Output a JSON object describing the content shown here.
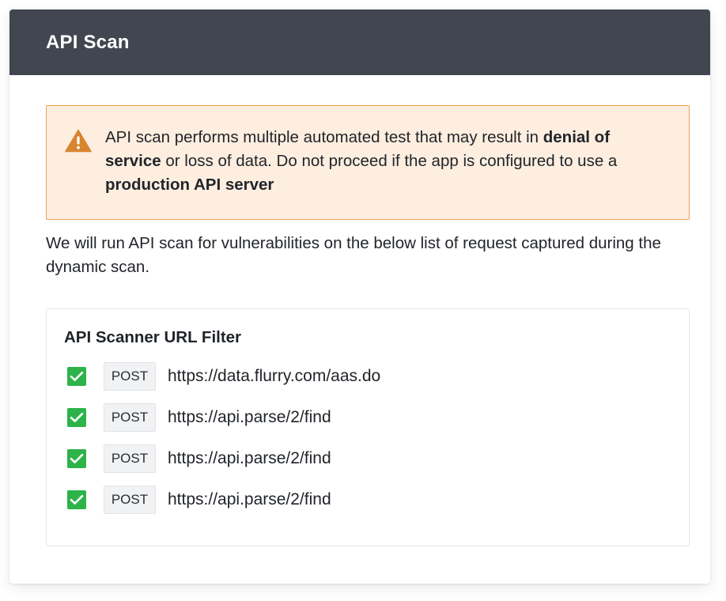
{
  "header": {
    "title": "API Scan"
  },
  "warning": {
    "icon": "warning-triangle-icon",
    "color": "#d8852e",
    "text_before": "API scan performs multiple automated test that may result in ",
    "bold_1": "denial of service",
    "text_middle": " or loss of data. Do not proceed if the app is configured to use a ",
    "bold_2": "production API server"
  },
  "intro": "We will run API scan for vulnerabilities on the below list of request captured during the dynamic scan.",
  "filter": {
    "title": "API Scanner URL Filter",
    "check_color": "#2db34a",
    "items": [
      {
        "checked": true,
        "method": "POST",
        "url": "https://data.flurry.com/aas.do"
      },
      {
        "checked": true,
        "method": "POST",
        "url": "https://api.parse/2/find"
      },
      {
        "checked": true,
        "method": "POST",
        "url": "https://api.parse/2/find"
      },
      {
        "checked": true,
        "method": "POST",
        "url": "https://api.parse/2/find"
      }
    ]
  }
}
